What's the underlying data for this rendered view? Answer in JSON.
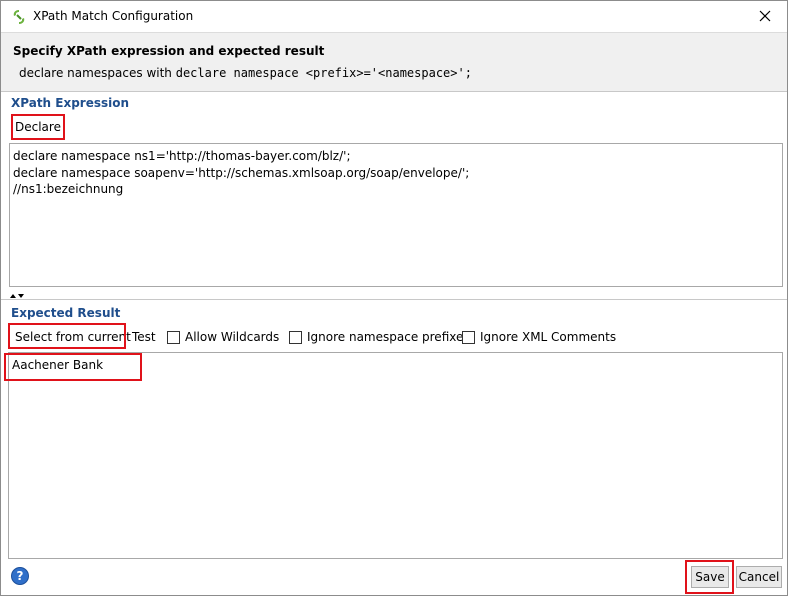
{
  "window": {
    "title": "XPath Match Configuration",
    "close_icon": "close-icon",
    "app_icon": "soapui-icon"
  },
  "header": {
    "title": "Specify XPath expression and expected result",
    "desc_prefix": "declare namespaces with ",
    "desc_code": "declare namespace <prefix>='<namespace>';"
  },
  "xpath_section": {
    "label": "XPath Expression",
    "declare_button": "Declare",
    "expression": "declare namespace ns1='http://thomas-bayer.com/blz/';\ndeclare namespace soapenv='http://schemas.xmlsoap.org/soap/envelope/';\n//ns1:bezeichnung"
  },
  "expected_section": {
    "label": "Expected Result",
    "select_button": "Select from current",
    "test_button": "Test",
    "options": [
      {
        "label": "Allow Wildcards",
        "checked": false
      },
      {
        "label": "Ignore namespace prefixes",
        "checked": false
      },
      {
        "label": "Ignore XML Comments",
        "checked": false
      }
    ],
    "result": "Aachener Bank"
  },
  "footer": {
    "save_label": "Save",
    "cancel_label": "Cancel",
    "help_icon": "help-icon"
  },
  "colors": {
    "highlight": "#e0121a",
    "section_label": "#1f4e8c",
    "header_bg": "#f0f0f0"
  }
}
